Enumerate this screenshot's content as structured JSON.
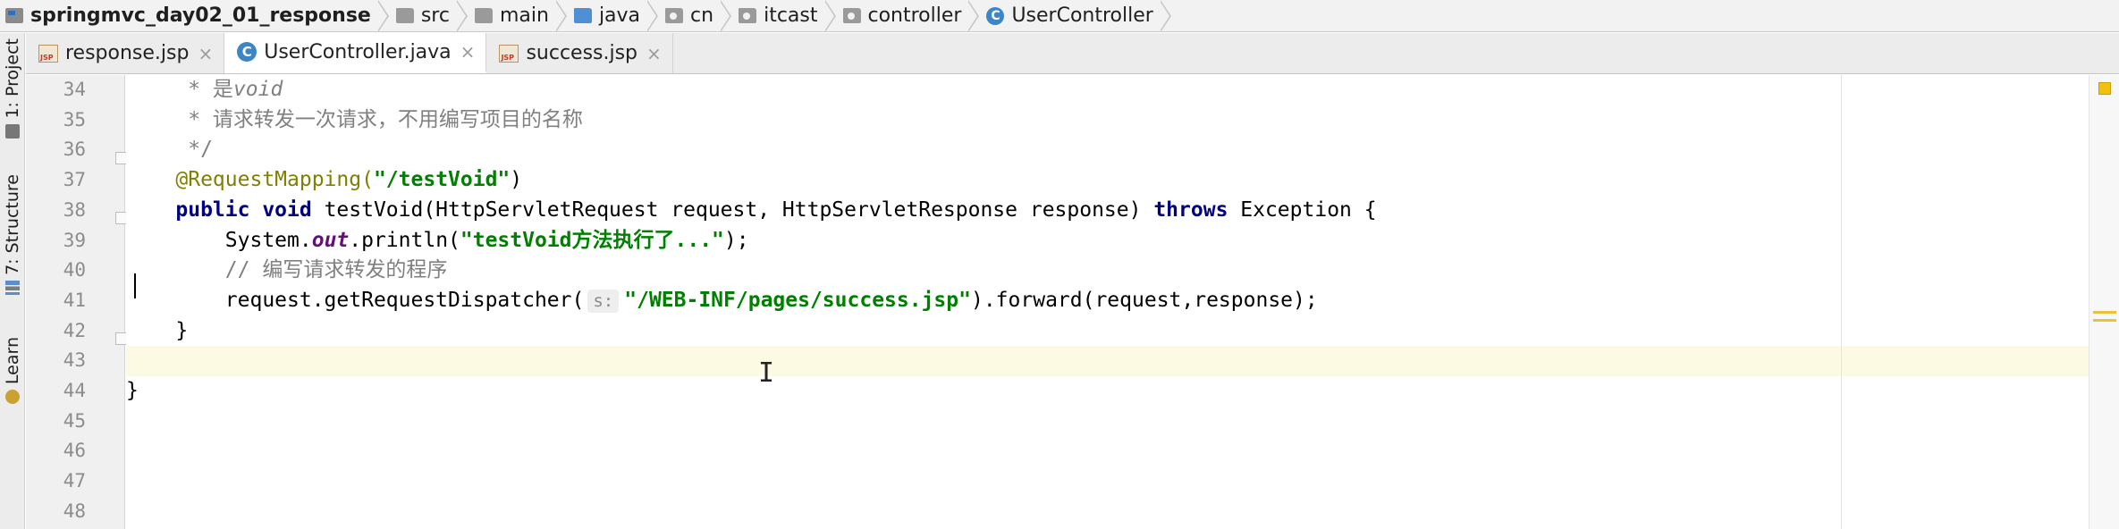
{
  "breadcrumb": {
    "project": "springmvc_day02_01_response",
    "items": [
      "src",
      "main",
      "java",
      "cn",
      "itcast",
      "controller",
      "UserController"
    ]
  },
  "tool_windows": {
    "project": "1: Project",
    "structure": "7: Structure",
    "learn": "Learn"
  },
  "tabs": [
    {
      "label": "response.jsp",
      "type": "jsp",
      "close": "×"
    },
    {
      "label": "UserController.java",
      "type": "class",
      "close": "×"
    },
    {
      "label": "success.jsp",
      "type": "jsp",
      "close": "×"
    }
  ],
  "icons": {
    "class_letter": "C",
    "jsp_badge": "JSP"
  },
  "editor": {
    "active_tab_index": 1,
    "current_line": 43,
    "line_numbers": [
      "34",
      "35",
      "36",
      "37",
      "38",
      "39",
      "40",
      "41",
      "42",
      "43",
      "44",
      "45",
      "46",
      "47",
      "48"
    ],
    "code": {
      "l34_prefix": "     * 是",
      "l34_void": "void",
      "l35": "     * 请求转发一次请求，不用编写项目的名称",
      "l36": "     */",
      "l37_ann": "    @RequestMapping(",
      "l37_str": "\"/testVoid\"",
      "l37_end": ")",
      "l38_kw1": "    public void ",
      "l38_mid": "testVoid(HttpServletRequest request, HttpServletResponse response) ",
      "l38_kw2": "throws",
      "l38_end": " Exception {",
      "l39_a": "        System.",
      "l39_field": "out",
      "l39_b": ".println(",
      "l39_str": "\"testVoid方法执行了...\"",
      "l39_end": ");",
      "l40": "        // 编写请求转发的程序",
      "l41_a": "        request.getRequestDispatcher(",
      "l41_hint": "s:",
      "l41_str": "\"/WEB-INF/pages/success.jsp\"",
      "l41_end": ").forward(request,response);",
      "l42": "    }",
      "l44": "}"
    }
  },
  "colors": {
    "keyword": "#000080",
    "string": "#008000",
    "annotation": "#808000",
    "comment": "#808080",
    "field": "#660e7a",
    "current_line": "#fcfae3"
  }
}
